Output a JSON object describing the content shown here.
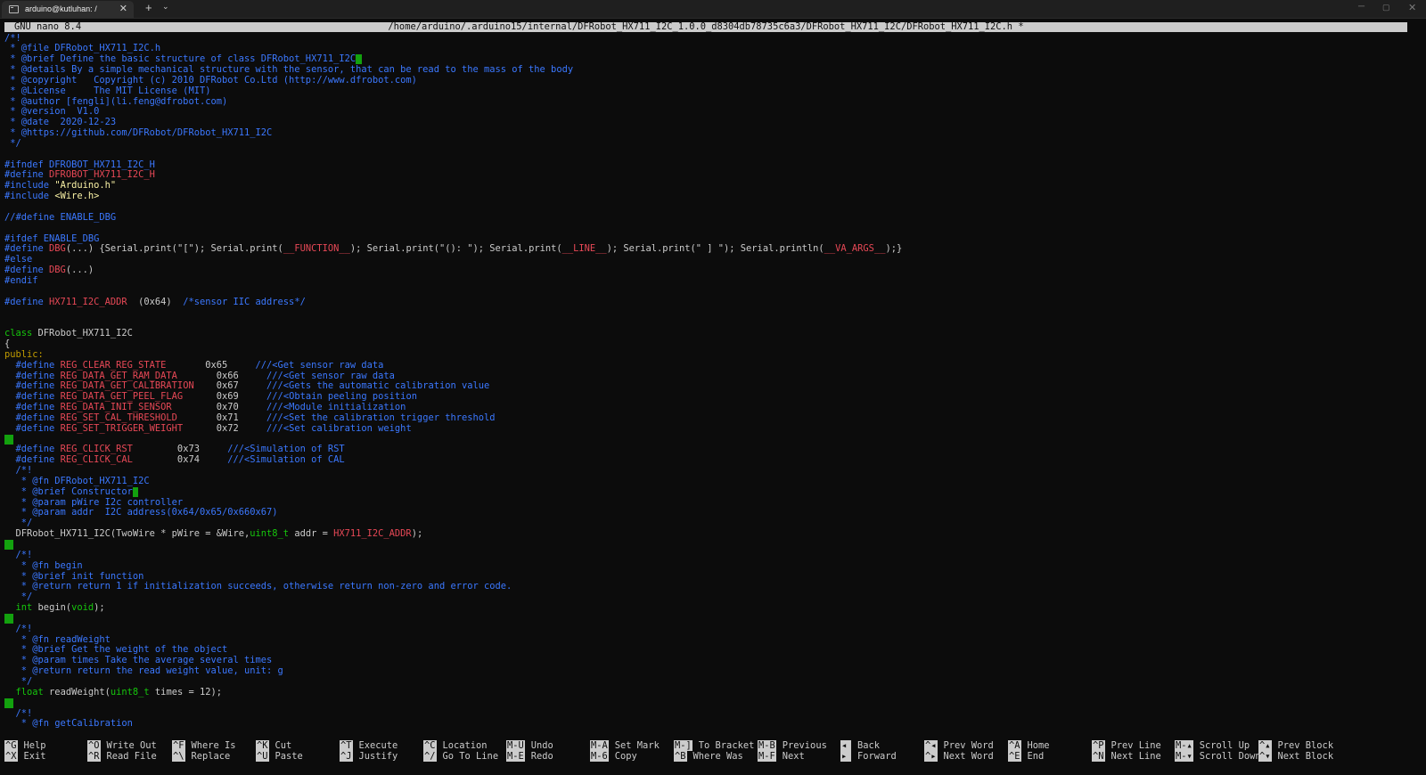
{
  "window": {
    "tab_title": "arduino@kutluhan: /",
    "tab_close": "✕",
    "new_tab": "+",
    "tab_menu": "⌄",
    "min": "─",
    "max": "▢",
    "close": "✕"
  },
  "nano": {
    "version": "GNU nano 8.4",
    "file_path": "/home/arduino/.arduino15/internal/DFRobot_HX711_I2C_1.0.0_d8304db78735c6a3/DFRobot_HX711_I2C/DFRobot_HX711_I2C.h *"
  },
  "colors": {
    "comment": "#3b78ff",
    "macro": "#e74856",
    "string": "#f9f1a5",
    "keyword": "#16c60c",
    "cursor": "#13a10e",
    "background": "#0c0c0c",
    "titlebar": "#cccccc"
  },
  "code_lines": [
    [
      {
        "t": "/*!",
        "c": "cmt"
      }
    ],
    [
      {
        "t": " * @file DFRobot_HX711_I2C.h",
        "c": "cmt"
      }
    ],
    [
      {
        "t": " * @brief Define the basic structure of class DFRobot_HX711_I2C",
        "c": "cmt"
      },
      {
        "t": "",
        "c": "cursor"
      }
    ],
    [
      {
        "t": " * @details By a simple mechanical structure with the sensor, that can be read to the mass of the body",
        "c": "cmt"
      }
    ],
    [
      {
        "t": " * @copyright   Copyright (c) 2010 DFRobot Co.Ltd (http://www.dfrobot.com)",
        "c": "cmt"
      }
    ],
    [
      {
        "t": " * @License     The MIT License (MIT)",
        "c": "cmt"
      }
    ],
    [
      {
        "t": " * @author [fengli](li.feng@dfrobot.com)",
        "c": "cmt"
      }
    ],
    [
      {
        "t": " * @version  V1.0",
        "c": "cmt"
      }
    ],
    [
      {
        "t": " * @date  2020-12-23",
        "c": "cmt"
      }
    ],
    [
      {
        "t": " * @https://github.com/DFRobot/DFRobot_HX711_I2C",
        "c": "cmt"
      }
    ],
    [
      {
        "t": " */",
        "c": "cmt"
      }
    ],
    [],
    [
      {
        "t": "#ifndef ",
        "c": "pp"
      },
      {
        "t": "DFROBOT_HX711_I2C_H",
        "c": "pp"
      }
    ],
    [
      {
        "t": "#define ",
        "c": "pp"
      },
      {
        "t": "DFROBOT_HX711_I2C_H",
        "c": "mac"
      }
    ],
    [
      {
        "t": "#include ",
        "c": "pp"
      },
      {
        "t": "\"Arduino.h\"",
        "c": "str"
      }
    ],
    [
      {
        "t": "#include ",
        "c": "pp"
      },
      {
        "t": "<Wire.h>",
        "c": "str"
      }
    ],
    [],
    [
      {
        "t": "//#define ENABLE_DBG",
        "c": "cmt"
      }
    ],
    [],
    [
      {
        "t": "#ifdef ENABLE_DBG",
        "c": "pp"
      }
    ],
    [
      {
        "t": "#define ",
        "c": "pp"
      },
      {
        "t": "DBG",
        "c": "mac"
      },
      {
        "t": "(...) {Serial.print(\"[\"); Serial.print(",
        "c": "txt"
      },
      {
        "t": "__FUNCTION__",
        "c": "mac"
      },
      {
        "t": "); Serial.print(\"(): \"); Serial.print(",
        "c": "txt"
      },
      {
        "t": "__LINE__",
        "c": "mac"
      },
      {
        "t": "); Serial.print(\" ] \"); Serial.println(",
        "c": "txt"
      },
      {
        "t": "__VA_ARGS__",
        "c": "mac"
      },
      {
        "t": ");}",
        "c": "txt"
      }
    ],
    [
      {
        "t": "#else",
        "c": "pp"
      }
    ],
    [
      {
        "t": "#define ",
        "c": "pp"
      },
      {
        "t": "DBG",
        "c": "mac"
      },
      {
        "t": "(...)",
        "c": "txt"
      }
    ],
    [
      {
        "t": "#endif",
        "c": "pp"
      }
    ],
    [],
    [
      {
        "t": "#define ",
        "c": "pp"
      },
      {
        "t": "HX711_I2C_ADDR",
        "c": "mac"
      },
      {
        "t": "  (0x64)  ",
        "c": "txt"
      },
      {
        "t": "/*sensor IIC address*/",
        "c": "cmt"
      }
    ],
    [],
    [],
    [
      {
        "t": "class ",
        "c": "kw"
      },
      {
        "t": "DFRobot_HX711_I2C",
        "c": "txt"
      }
    ],
    [
      {
        "t": "{",
        "c": "txt"
      }
    ],
    [
      {
        "t": "public:",
        "c": "pub"
      }
    ],
    [
      {
        "t": "  #define ",
        "c": "pp"
      },
      {
        "t": "REG_CLEAR_REG_STATE",
        "c": "mac"
      },
      {
        "t": "       0x65     ",
        "c": "txt"
      },
      {
        "t": "///<Get sensor raw data",
        "c": "cmt"
      }
    ],
    [
      {
        "t": "  #define ",
        "c": "pp"
      },
      {
        "t": "REG_DATA_GET_RAM_DATA",
        "c": "mac"
      },
      {
        "t": "       0x66     ",
        "c": "txt"
      },
      {
        "t": "///<Get sensor raw data",
        "c": "cmt"
      }
    ],
    [
      {
        "t": "  #define ",
        "c": "pp"
      },
      {
        "t": "REG_DATA_GET_CALIBRATION",
        "c": "mac"
      },
      {
        "t": "    0x67     ",
        "c": "txt"
      },
      {
        "t": "///<Gets the automatic calibration value",
        "c": "cmt"
      }
    ],
    [
      {
        "t": "  #define ",
        "c": "pp"
      },
      {
        "t": "REG_DATA_GET_PEEL_FLAG",
        "c": "mac"
      },
      {
        "t": "      0x69     ",
        "c": "txt"
      },
      {
        "t": "///<Obtain peeling position",
        "c": "cmt"
      }
    ],
    [
      {
        "t": "  #define ",
        "c": "pp"
      },
      {
        "t": "REG_DATA_INIT_SENSOR",
        "c": "mac"
      },
      {
        "t": "        0x70     ",
        "c": "txt"
      },
      {
        "t": "///<Module initialization",
        "c": "cmt"
      }
    ],
    [
      {
        "t": "  #define ",
        "c": "pp"
      },
      {
        "t": "REG_SET_CAL_THRESHOLD",
        "c": "mac"
      },
      {
        "t": "       0x71     ",
        "c": "txt"
      },
      {
        "t": "///<Set the calibration trigger threshold",
        "c": "cmt"
      }
    ],
    [
      {
        "t": "  #define ",
        "c": "pp"
      },
      {
        "t": "REG_SET_TRIGGER_WEIGHT",
        "c": "mac"
      },
      {
        "t": "      0x72     ",
        "c": "txt"
      },
      {
        "t": "///<Set calibration weight",
        "c": "cmt"
      }
    ],
    [
      {
        "t": "",
        "c": "gutter"
      }
    ],
    [
      {
        "t": "  #define ",
        "c": "pp"
      },
      {
        "t": "REG_CLICK_RST",
        "c": "mac"
      },
      {
        "t": "        0x73     ",
        "c": "txt"
      },
      {
        "t": "///<Simulation of RST",
        "c": "cmt"
      }
    ],
    [
      {
        "t": "  #define ",
        "c": "pp"
      },
      {
        "t": "REG_CLICK_CAL",
        "c": "mac"
      },
      {
        "t": "        0x74     ",
        "c": "txt"
      },
      {
        "t": "///<Simulation of CAL",
        "c": "cmt"
      }
    ],
    [
      {
        "t": "  /*!",
        "c": "cmt"
      }
    ],
    [
      {
        "t": "   * @fn DFRobot_HX711_I2C",
        "c": "cmt"
      }
    ],
    [
      {
        "t": "   * @brief Constructor",
        "c": "cmt"
      },
      {
        "t": "",
        "c": "cursor"
      }
    ],
    [
      {
        "t": "   * @param pWire I2c controller",
        "c": "cmt"
      }
    ],
    [
      {
        "t": "   * @param addr  I2C address(0x64/0x65/0x660x67)",
        "c": "cmt"
      }
    ],
    [
      {
        "t": "   */",
        "c": "cmt"
      }
    ],
    [
      {
        "t": "  DFRobot_HX711_I2C(TwoWire * pWire = &Wire,",
        "c": "txt"
      },
      {
        "t": "uint8_t",
        "c": "kw"
      },
      {
        "t": " addr = ",
        "c": "txt"
      },
      {
        "t": "HX711_I2C_ADDR",
        "c": "mac"
      },
      {
        "t": ");",
        "c": "txt"
      }
    ],
    [
      {
        "t": "",
        "c": "gutter"
      }
    ],
    [
      {
        "t": "  /*!",
        "c": "cmt"
      }
    ],
    [
      {
        "t": "   * @fn begin",
        "c": "cmt"
      }
    ],
    [
      {
        "t": "   * @brief init function",
        "c": "cmt"
      }
    ],
    [
      {
        "t": "   * @return return 1 if initialization succeeds, otherwise return non-zero and error code.",
        "c": "cmt"
      }
    ],
    [
      {
        "t": "   */",
        "c": "cmt"
      }
    ],
    [
      {
        "t": "  ",
        "c": "txt"
      },
      {
        "t": "int",
        "c": "kw"
      },
      {
        "t": " begin(",
        "c": "txt"
      },
      {
        "t": "void",
        "c": "kw"
      },
      {
        "t": ");",
        "c": "txt"
      }
    ],
    [
      {
        "t": "",
        "c": "gutter"
      }
    ],
    [
      {
        "t": "  /*!",
        "c": "cmt"
      }
    ],
    [
      {
        "t": "   * @fn readWeight",
        "c": "cmt"
      }
    ],
    [
      {
        "t": "   * @brief Get the weight of the object",
        "c": "cmt"
      }
    ],
    [
      {
        "t": "   * @param times Take the average several times",
        "c": "cmt"
      }
    ],
    [
      {
        "t": "   * @return return the read weight value, unit: g",
        "c": "cmt"
      }
    ],
    [
      {
        "t": "   */",
        "c": "cmt"
      }
    ],
    [
      {
        "t": "  ",
        "c": "txt"
      },
      {
        "t": "float",
        "c": "kw"
      },
      {
        "t": " readWeight(",
        "c": "txt"
      },
      {
        "t": "uint8_t",
        "c": "kw"
      },
      {
        "t": " times = 12);",
        "c": "txt"
      }
    ],
    [
      {
        "t": "",
        "c": "gutter"
      }
    ],
    [
      {
        "t": "  /*!",
        "c": "cmt"
      }
    ],
    [
      {
        "t": "   * @fn getCalibration",
        "c": "cmt"
      }
    ]
  ],
  "shortcuts": [
    {
      "top": {
        "key": "^G",
        "label": "Help"
      },
      "bottom": {
        "key": "^X",
        "label": "Exit"
      }
    },
    {
      "top": {
        "key": "^O",
        "label": "Write Out"
      },
      "bottom": {
        "key": "^R",
        "label": "Read File"
      }
    },
    {
      "top": {
        "key": "^F",
        "label": "Where Is"
      },
      "bottom": {
        "key": "^\\",
        "label": "Replace"
      }
    },
    {
      "top": {
        "key": "^K",
        "label": "Cut"
      },
      "bottom": {
        "key": "^U",
        "label": "Paste"
      }
    },
    {
      "top": {
        "key": "^T",
        "label": "Execute"
      },
      "bottom": {
        "key": "^J",
        "label": "Justify"
      }
    },
    {
      "top": {
        "key": "^C",
        "label": "Location"
      },
      "bottom": {
        "key": "^/",
        "label": "Go To Line"
      }
    },
    {
      "top": {
        "key": "M-U",
        "label": "Undo"
      },
      "bottom": {
        "key": "M-E",
        "label": "Redo"
      }
    },
    {
      "top": {
        "key": "M-A",
        "label": "Set Mark"
      },
      "bottom": {
        "key": "M-6",
        "label": "Copy"
      }
    },
    {
      "top": {
        "key": "M-]",
        "label": "To Bracket"
      },
      "bottom": {
        "key": "^B",
        "label": "Where Was"
      }
    },
    {
      "top": {
        "key": "M-B",
        "label": "Previous"
      },
      "bottom": {
        "key": "M-F",
        "label": "Next"
      }
    },
    {
      "top": {
        "key": "◂",
        "label": "Back"
      },
      "bottom": {
        "key": "▸",
        "label": "Forward"
      }
    },
    {
      "top": {
        "key": "^◂",
        "label": "Prev Word"
      },
      "bottom": {
        "key": "^▸",
        "label": "Next Word"
      }
    },
    {
      "top": {
        "key": "^A",
        "label": "Home"
      },
      "bottom": {
        "key": "^E",
        "label": "End"
      }
    },
    {
      "top": {
        "key": "^P",
        "label": "Prev Line"
      },
      "bottom": {
        "key": "^N",
        "label": "Next Line"
      }
    },
    {
      "top": {
        "key": "M-▴",
        "label": "Scroll Up"
      },
      "bottom": {
        "key": "M-▾",
        "label": "Scroll Down"
      }
    },
    {
      "top": {
        "key": "^▴",
        "label": "Prev Block"
      },
      "bottom": {
        "key": "^▾",
        "label": "Next Block"
      }
    }
  ]
}
